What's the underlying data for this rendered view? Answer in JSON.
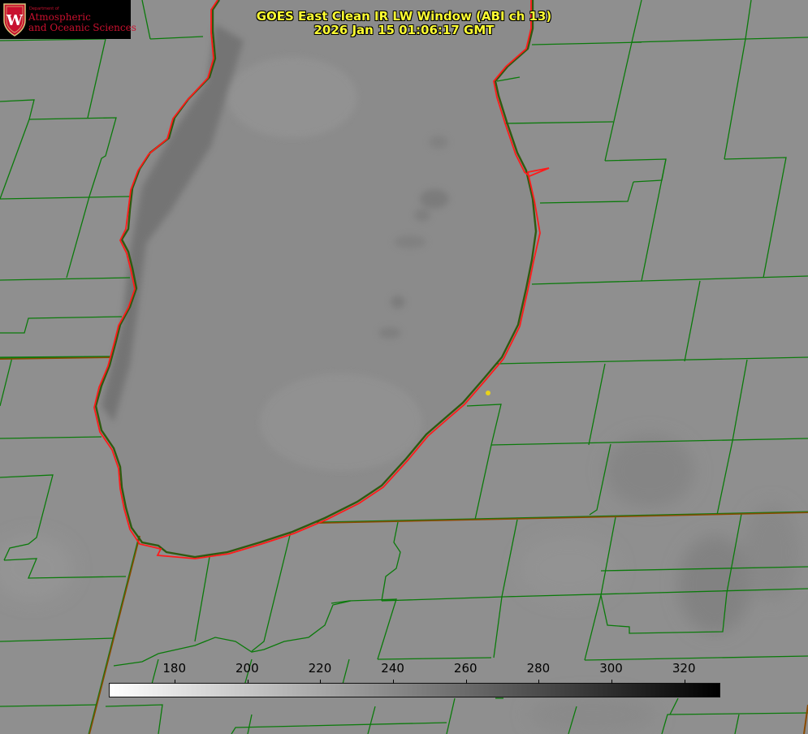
{
  "product": {
    "title": "GOES East Clean IR LW Window (ABI ch 13)",
    "timestamp": "2026 Jan 15 01:06:17 GMT"
  },
  "logo": {
    "department": "Department of",
    "line1": "Atmospheric",
    "line2": "and Oceanic Sciences",
    "seal_letter": "W",
    "brand_color": "#c8102e"
  },
  "colorbar": {
    "ticks": [
      "180",
      "200",
      "220",
      "240",
      "260",
      "280",
      "300",
      "320"
    ],
    "range": [
      162,
      330
    ],
    "colormap": "white-to-black grayscale"
  },
  "map": {
    "county_line_color": "#0b7a0b",
    "state_line_color": "#8a4a00",
    "coastline_color": "#ff1a1a",
    "point_marker_color": "#e8d21a"
  }
}
